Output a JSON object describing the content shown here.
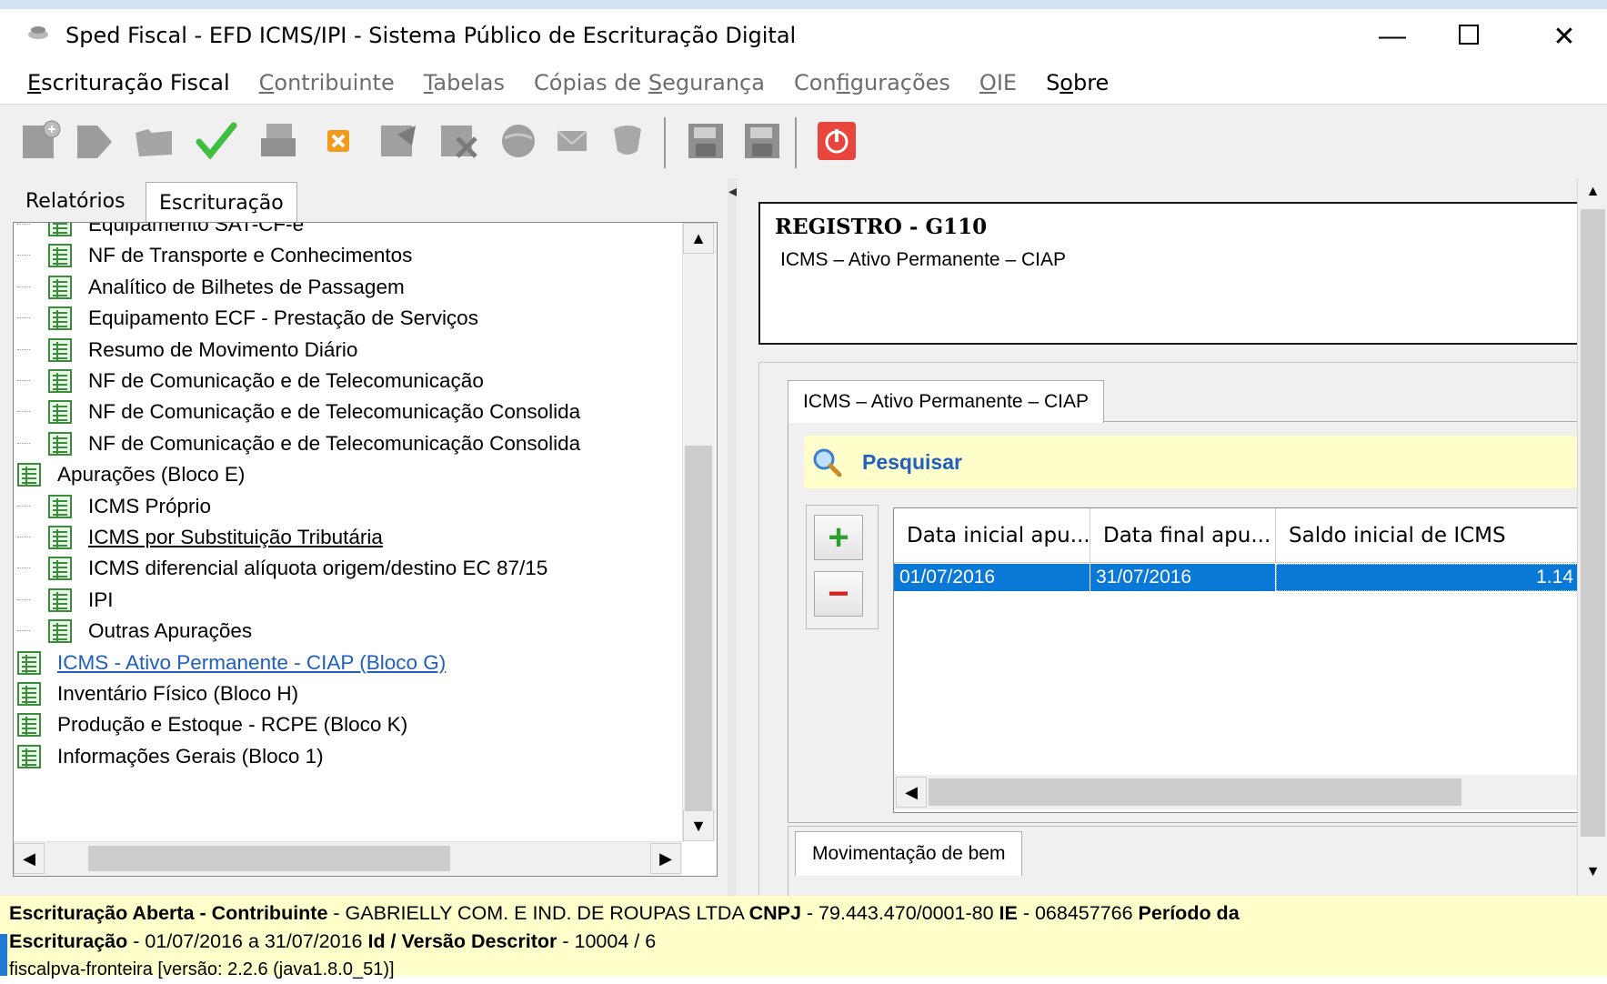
{
  "window": {
    "title": "Sped Fiscal - EFD ICMS/IPI - Sistema Público de Escrituração Digital",
    "min_glyph": "—",
    "max_glyph": "☐",
    "close_glyph": "✕"
  },
  "menu": [
    {
      "pre": "",
      "u": "E",
      "post": "scrituração Fiscal",
      "state": "active"
    },
    {
      "pre": "",
      "u": "C",
      "post": "ontribuinte",
      "state": "disabled"
    },
    {
      "pre": "",
      "u": "T",
      "post": "abelas",
      "state": "disabled"
    },
    {
      "pre": "Cópias de ",
      "u": "S",
      "post": "egurança",
      "state": "disabled"
    },
    {
      "pre": "Con",
      "u": "f",
      "post": "igurações",
      "state": "disabled"
    },
    {
      "pre": "",
      "u": "O",
      "post": "IE",
      "state": "disabled"
    },
    {
      "pre": "S",
      "u": "o",
      "post": "bre",
      "state": "active"
    }
  ],
  "toolbar_icons": [
    "new-icon",
    "next-icon",
    "open-folder-icon",
    "check-icon",
    "save-disk-icon",
    "delete-icon",
    "signature-icon",
    "signature-remove-icon",
    "globe-icon",
    "mail-icon",
    "shield-icon",
    "save-icon",
    "save-as-icon",
    "power-icon"
  ],
  "left_tabs": {
    "reports": "Relatórios",
    "bookkeeping": "Escrituração"
  },
  "tree": [
    {
      "label": "Equipamento SAT-CF-e",
      "level": 2,
      "style": ""
    },
    {
      "label": "NF de Transporte e Conhecimentos",
      "level": 2,
      "style": ""
    },
    {
      "label": "Analítico de Bilhetes de Passagem",
      "level": 2,
      "style": ""
    },
    {
      "label": "Equipamento ECF - Prestação de Serviços",
      "level": 2,
      "style": ""
    },
    {
      "label": "Resumo de Movimento Diário",
      "level": 2,
      "style": ""
    },
    {
      "label": "NF de Comunicação e de Telecomunicação",
      "level": 2,
      "style": ""
    },
    {
      "label": "NF de Comunicação e de Telecomunicação Consolida",
      "level": 2,
      "style": ""
    },
    {
      "label": "NF de Comunicação e de Telecomunicação Consolida",
      "level": 2,
      "style": ""
    },
    {
      "label": "Apurações (Bloco E)",
      "level": 1,
      "style": ""
    },
    {
      "label": "ICMS Próprio",
      "level": 2,
      "style": ""
    },
    {
      "label": "ICMS por Substituição Tributária",
      "level": 2,
      "style": "ul"
    },
    {
      "label": "ICMS diferencial alíquota origem/destino EC 87/15",
      "level": 2,
      "style": ""
    },
    {
      "label": "IPI",
      "level": 2,
      "style": ""
    },
    {
      "label": "Outras Apurações",
      "level": 2,
      "style": ""
    },
    {
      "label": "ICMS - Ativo Permanente - CIAP (Bloco G)",
      "level": 1,
      "style": "link"
    },
    {
      "label": "Inventário Físico (Bloco H)",
      "level": 1,
      "style": ""
    },
    {
      "label": "Produção e Estoque - RCPE (Bloco K)",
      "level": 1,
      "style": ""
    },
    {
      "label": "Informações Gerais (Bloco 1)",
      "level": 1,
      "style": ""
    }
  ],
  "register": {
    "code": "REGISTRO - G110",
    "description": "ICMS – Ativo Permanente – CIAP"
  },
  "ciap_tab": "ICMS – Ativo Permanente – CIAP",
  "search_label": "Pesquisar",
  "grid": {
    "columns": [
      "Data inicial apu...",
      "Data final apu...",
      "Saldo inicial de ICMS"
    ],
    "rows": [
      [
        "01/07/2016",
        "31/07/2016",
        "1.14"
      ]
    ]
  },
  "mov_tab": "Movimentação de bem",
  "status": {
    "l1_k1": "Escrituração Aberta - Contribuinte",
    "l1_v1": " - GABRIELLY COM. E IND. DE ROUPAS LTDA ",
    "l1_k2": "CNPJ",
    "l1_v2": " - 79.443.470/0001-80 ",
    "l1_k3": "IE",
    "l1_v3": " - 068457766 ",
    "l1_k4": "Período da",
    "l2_k1": "Escrituração",
    "l2_v1": " - 01/07/2016 a 31/07/2016 ",
    "l2_k2": "Id / Versão Descritor",
    "l2_v2": " - 10004 / 6",
    "l3": "fiscalpva-fronteira [versão: 2.2.6 (java1.8.0_51)]"
  }
}
